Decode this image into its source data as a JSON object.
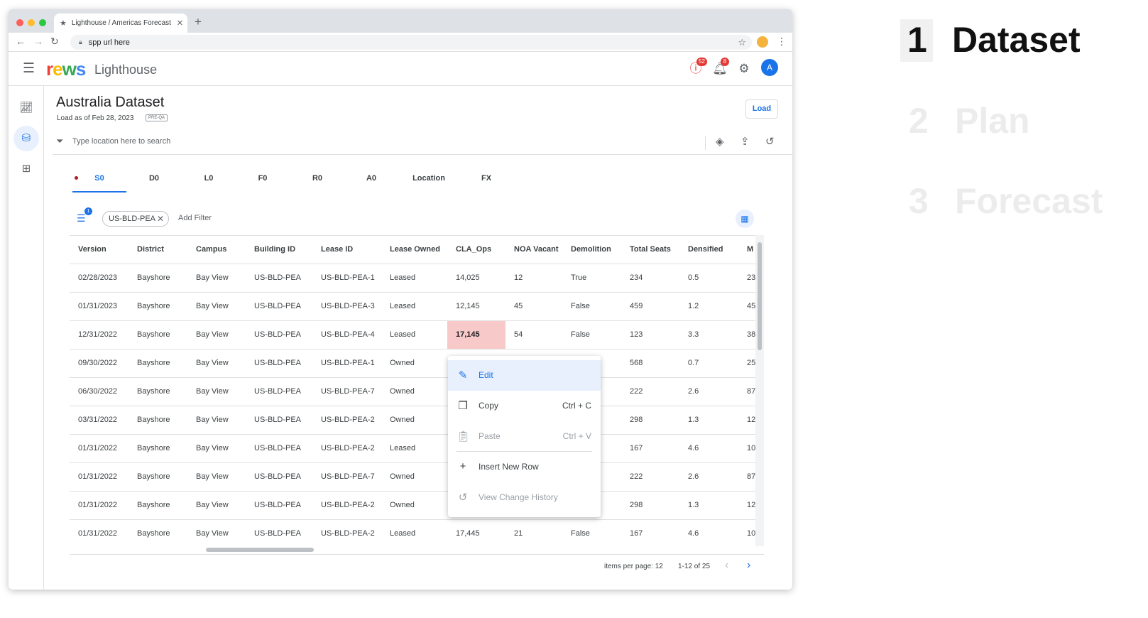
{
  "browser": {
    "tab_title": "Lighthouse / Americas Forecast",
    "url": "spp url here"
  },
  "app": {
    "logo": "rews",
    "name": "Lighthouse",
    "alerts_count": "52",
    "notifications_count": "8",
    "avatar_initial": "A"
  },
  "page": {
    "title": "Australia Dataset",
    "load_as_of": "Load as of Feb 28, 2023",
    "env_badge": "PRE-QA",
    "load_button": "Load",
    "search_placeholder": "Type location here to search"
  },
  "dataset_tabs": [
    "S0",
    "D0",
    "L0",
    "F0",
    "R0",
    "A0",
    "Location",
    "FX"
  ],
  "active_tab": "S0",
  "filters": {
    "count": "1",
    "chip": "US-BLD-PEA",
    "add_filter": "Add Filter"
  },
  "table": {
    "columns": [
      "Version",
      "District",
      "Campus",
      "Building ID",
      "Lease ID",
      "Lease Owned",
      "CLA_Ops",
      "NOA Vacant",
      "Demolition",
      "Total Seats",
      "Densified",
      "M"
    ],
    "rows": [
      [
        "02/28/2023",
        "Bayshore",
        "Bay View",
        "US-BLD-PEA",
        "US-BLD-PEA-1",
        "Leased",
        "14,025",
        "12",
        "True",
        "234",
        "0.5",
        "23"
      ],
      [
        "01/31/2023",
        "Bayshore",
        "Bay View",
        "US-BLD-PEA",
        "US-BLD-PEA-3",
        "Leased",
        "12,145",
        "45",
        "False",
        "459",
        "1.2",
        "45"
      ],
      [
        "12/31/2022",
        "Bayshore",
        "Bay View",
        "US-BLD-PEA",
        "US-BLD-PEA-4",
        "Leased",
        "17,145",
        "54",
        "False",
        "123",
        "3.3",
        "38"
      ],
      [
        "09/30/2022",
        "Bayshore",
        "Bay View",
        "US-BLD-PEA",
        "US-BLD-PEA-1",
        "Owned",
        "",
        "",
        "",
        "568",
        "0.7",
        "25"
      ],
      [
        "06/30/2022",
        "Bayshore",
        "Bay View",
        "US-BLD-PEA",
        "US-BLD-PEA-7",
        "Owned",
        "",
        "",
        "",
        "222",
        "2.6",
        "87"
      ],
      [
        "03/31/2022",
        "Bayshore",
        "Bay View",
        "US-BLD-PEA",
        "US-BLD-PEA-2",
        "Owned",
        "",
        "",
        "",
        "298",
        "1.3",
        "12"
      ],
      [
        "01/31/2022",
        "Bayshore",
        "Bay View",
        "US-BLD-PEA",
        "US-BLD-PEA-2",
        "Leased",
        "",
        "",
        "",
        "167",
        "4.6",
        "10"
      ],
      [
        "01/31/2022",
        "Bayshore",
        "Bay View",
        "US-BLD-PEA",
        "US-BLD-PEA-7",
        "Owned",
        "",
        "",
        "",
        "222",
        "2.6",
        "87"
      ],
      [
        "01/31/2022",
        "Bayshore",
        "Bay View",
        "US-BLD-PEA",
        "US-BLD-PEA-2",
        "Owned",
        "",
        "",
        "",
        "298",
        "1.3",
        "12"
      ],
      [
        "01/31/2022",
        "Bayshore",
        "Bay View",
        "US-BLD-PEA",
        "US-BLD-PEA-2",
        "Leased",
        "17,445",
        "21",
        "False",
        "167",
        "4.6",
        "10"
      ]
    ],
    "highlighted_cell": {
      "row": 2,
      "column": "CLA_Ops",
      "color": "#f8c9c9"
    }
  },
  "context_menu": {
    "items": [
      {
        "label": "Edit",
        "shortcut": "",
        "icon": "pencil-icon",
        "state": "active"
      },
      {
        "label": "Copy",
        "shortcut": "Ctrl + C",
        "icon": "copy-icon",
        "state": "enabled"
      },
      {
        "label": "Paste",
        "shortcut": "Ctrl + V",
        "icon": "clipboard-icon",
        "state": "disabled"
      },
      {
        "label": "Insert New Row",
        "shortcut": "",
        "icon": "plus-icon",
        "state": "enabled"
      },
      {
        "label": "View Change History",
        "shortcut": "",
        "icon": "history-icon",
        "state": "disabled"
      }
    ]
  },
  "pagination": {
    "items_per_page": "items per page: 12",
    "range": "1-12 of 25"
  },
  "steps": [
    {
      "number": "1",
      "label": "Dataset",
      "state": "active"
    },
    {
      "number": "2",
      "label": "Plan",
      "state": "inactive"
    },
    {
      "number": "3",
      "label": "Forecast",
      "state": "inactive"
    }
  ],
  "colors": {
    "primary": "#1a73e8",
    "badge": "#e53935",
    "highlight": "#f8c9c9",
    "logo_r": "#ea4335",
    "logo_e": "#fbbc04",
    "logo_w": "#34a853",
    "logo_s": "#4285f4"
  }
}
